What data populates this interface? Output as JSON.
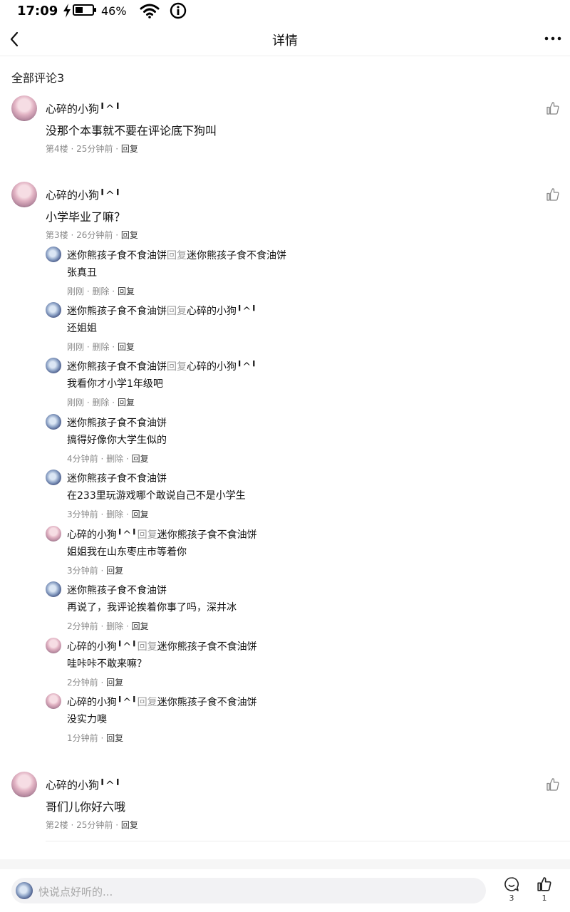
{
  "status_bar": {
    "time": "17:09",
    "battery_percent": "46%",
    "battery_level": 0.46
  },
  "nav": {
    "title": "详情"
  },
  "comments_header": {
    "label": "全部评论3"
  },
  "comments": [
    {
      "author": "心碎的小狗╹^╹",
      "text": "没那个本事就不要在评论底下狗叫",
      "floor": "第4楼",
      "time": "25分钟前",
      "reply_label": "回复",
      "replies": []
    },
    {
      "author": "心碎的小狗╹^╹",
      "text": "小学毕业了嘛？",
      "floor": "第3楼",
      "time": "26分钟前",
      "reply_label": "回复",
      "replies": [
        {
          "author": "迷你熊孩子食不食油饼",
          "reply_word": "回复",
          "target": "迷你熊孩子食不食油饼",
          "text": "张真丑",
          "time": "刚刚",
          "delete": "删除",
          "reply": "回复"
        },
        {
          "author": "迷你熊孩子食不食油饼",
          "reply_word": "回复",
          "target": "心碎的小狗╹^╹",
          "text": "还姐姐",
          "time": "刚刚",
          "delete": "删除",
          "reply": "回复"
        },
        {
          "author": "迷你熊孩子食不食油饼",
          "reply_word": "回复",
          "target": "心碎的小狗╹^╹",
          "text": "我看你才小学1年级吧",
          "time": "刚刚",
          "delete": "删除",
          "reply": "回复"
        },
        {
          "author": "迷你熊孩子食不食油饼",
          "reply_word": "",
          "target": "",
          "text": "搞得好像你大学生似的",
          "time": "4分钟前",
          "delete": "删除",
          "reply": "回复"
        },
        {
          "author": "迷你熊孩子食不食油饼",
          "reply_word": "",
          "target": "",
          "text": "在233里玩游戏哪个敢说自己不是小学生",
          "time": "3分钟前",
          "delete": "删除",
          "reply": "回复"
        },
        {
          "author": "心碎的小狗╹^╹",
          "reply_word": "回复",
          "target": "迷你熊孩子食不食油饼",
          "text": "姐姐我在山东枣庄市等着你",
          "time": "3分钟前",
          "delete": "",
          "reply": "回复"
        },
        {
          "author": "迷你熊孩子食不食油饼",
          "reply_word": "",
          "target": "",
          "text": "再说了，我评论挨着你事了吗，深井冰",
          "time": "2分钟前",
          "delete": "删除",
          "reply": "回复"
        },
        {
          "author": "心碎的小狗╹^╹",
          "reply_word": "回复",
          "target": "迷你熊孩子食不食油饼",
          "text": "哇咔咔不敢来嘛？",
          "time": "2分钟前",
          "delete": "",
          "reply": "回复"
        },
        {
          "author": "心碎的小狗╹^╹",
          "reply_word": "回复",
          "target": "迷你熊孩子食不食油饼",
          "text": "没实力噢",
          "time": "1分钟前",
          "delete": "",
          "reply": "回复"
        }
      ]
    },
    {
      "author": "心碎的小狗╹^╹",
      "text": "哥们儿你好六哦",
      "floor": "第2楼",
      "time": "25分钟前",
      "reply_label": "回复",
      "replies": []
    }
  ],
  "bottom_bar": {
    "placeholder": "快说点好听的...",
    "comment_count": "3",
    "like_count": "1"
  },
  "icons": {
    "back": "chevron-left-icon",
    "more": "more-dots-icon",
    "like": "thumb-up-icon",
    "comment": "comment-bubble-icon",
    "wifi": "wifi-icon",
    "info": "info-icon",
    "battery": "battery-icon"
  }
}
